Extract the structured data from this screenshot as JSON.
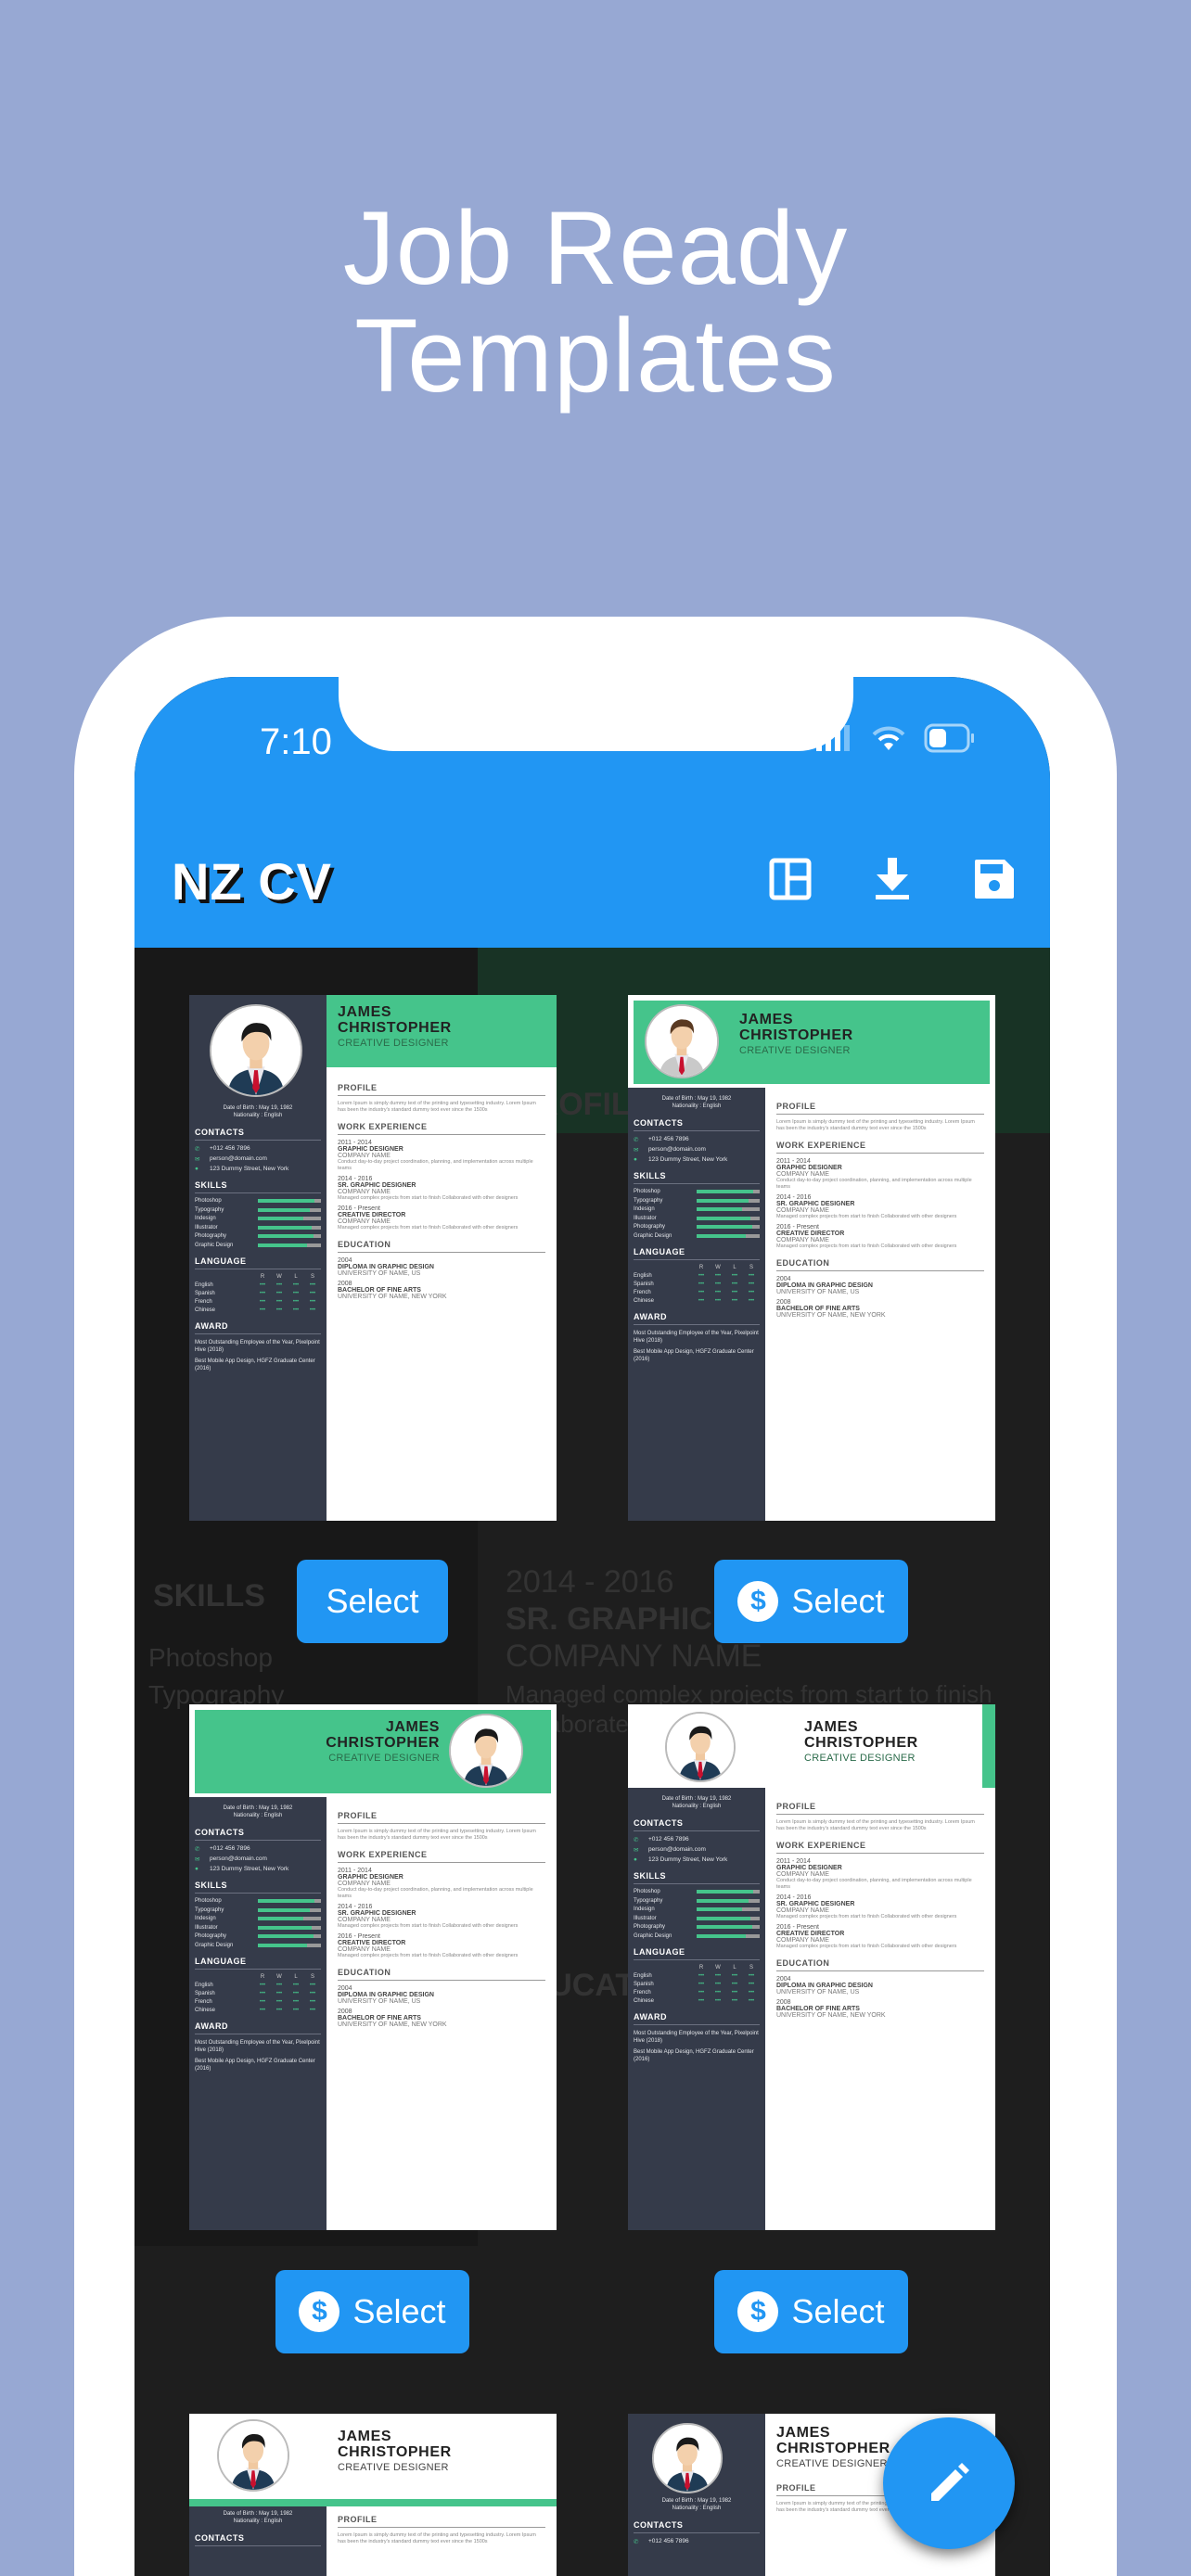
{
  "headline": {
    "line1": "Job Ready",
    "line2": "Templates"
  },
  "colors": {
    "background": "#97a8d3",
    "primary": "#2196f3",
    "resume_green": "#45c48b",
    "resume_sidebar": "#353b4a",
    "content_bg": "#1e1e1e"
  },
  "status_bar": {
    "time": "7:10",
    "icons": [
      "signal-icon",
      "wifi-icon",
      "battery-icon"
    ]
  },
  "app_bar": {
    "title": "NZ CV",
    "actions": [
      {
        "icon": "template-layout-icon"
      },
      {
        "icon": "download-icon"
      },
      {
        "icon": "save-icon"
      }
    ]
  },
  "background_document": {
    "texts": [
      "SKILLS",
      "Photoshop",
      "Typography",
      "2014 - 2016",
      "SR. GRAPHIC DESIGNER",
      "COMPANY NAME",
      "Managed complex projects from start to finish",
      "Collaborated with other designers",
      "PROFILE",
      "EDUCATION"
    ]
  },
  "resume": {
    "first_name": "JAMES",
    "last_name": "CHRISTOPHER",
    "role": "CREATIVE DESIGNER",
    "dob": "Date of Birth : May 19, 1982",
    "nationality": "Nationality : English",
    "sections": {
      "contacts": "CONTACTS",
      "skills": "SKILLS",
      "language": "LANGUAGE",
      "award": "AWARD",
      "profile": "PROFILE",
      "work": "WORK EXPERIENCE",
      "education": "EDUCATION"
    },
    "contacts": [
      {
        "icon": "phone-icon",
        "glyph": "✆",
        "text": "+012 456 7896"
      },
      {
        "icon": "email-icon",
        "glyph": "✉",
        "text": "person@domain.com"
      },
      {
        "icon": "location-icon",
        "glyph": "●",
        "text": "123 Dummy Street, New York"
      }
    ],
    "skills": [
      {
        "name": "Photoshop",
        "level": 0.9
      },
      {
        "name": "Typography",
        "level": 0.82
      },
      {
        "name": "Indesign",
        "level": 0.72
      },
      {
        "name": "Illustrator",
        "level": 0.86
      },
      {
        "name": "Photography",
        "level": 0.88
      },
      {
        "name": "Graphic Design",
        "level": 0.78
      }
    ],
    "language_cols": [
      "R",
      "W",
      "L",
      "S"
    ],
    "languages": [
      "English",
      "Spanish",
      "French",
      "Chinese"
    ],
    "language_mark": "•••",
    "awards": [
      "Most Outstanding Employee of the Year, Pixelpoint Hive (2018)",
      "Best Mobile App Design, HGFZ Graduate Center (2016)"
    ],
    "profile": "Lorem Ipsum is simply dummy text of the printing and typesetting industry. Lorem Ipsum has been the industry's standard dummy text ever since the 1500s",
    "work": [
      {
        "years": "2011 - 2014",
        "role": "GRAPHIC DESIGNER",
        "company": "COMPANY NAME",
        "desc": "Conduct day-to-day project coordination, planning, and implementation across multiple teams"
      },
      {
        "years": "2014 - 2016",
        "role": "SR. GRAPHIC DESIGNER",
        "company": "COMPANY NAME",
        "desc": "Managed complex projects from start to finish Collaborated with other designers"
      },
      {
        "years": "2016 - Present",
        "role": "CREATIVE DIRECTOR",
        "company": "COMPANY NAME",
        "desc": "Managed complex projects from start to finish Collaborated with other designers"
      }
    ],
    "education": [
      {
        "year": "2004",
        "degree": "DIPLOMA IN GRAPHIC DESIGN",
        "school": "UNIVERSITY OF NAME, US"
      },
      {
        "year": "2008",
        "degree": "BACHELOR OF FINE ARTS",
        "school": "UNIVERSITY OF NAME, NEW YORK"
      }
    ]
  },
  "templates": [
    {
      "id": "template-1",
      "premium": false,
      "select_label": "Select"
    },
    {
      "id": "template-2",
      "premium": true,
      "select_label": "Select"
    },
    {
      "id": "template-3",
      "premium": true,
      "select_label": "Select"
    },
    {
      "id": "template-4",
      "premium": true,
      "select_label": "Select"
    },
    {
      "id": "template-5",
      "premium": false,
      "select_label": ""
    },
    {
      "id": "template-6",
      "premium": false,
      "select_label": ""
    }
  ],
  "premium_icon": {
    "icon": "dollar-icon",
    "glyph": "$"
  },
  "fab": {
    "icon": "edit-pencil-icon"
  }
}
